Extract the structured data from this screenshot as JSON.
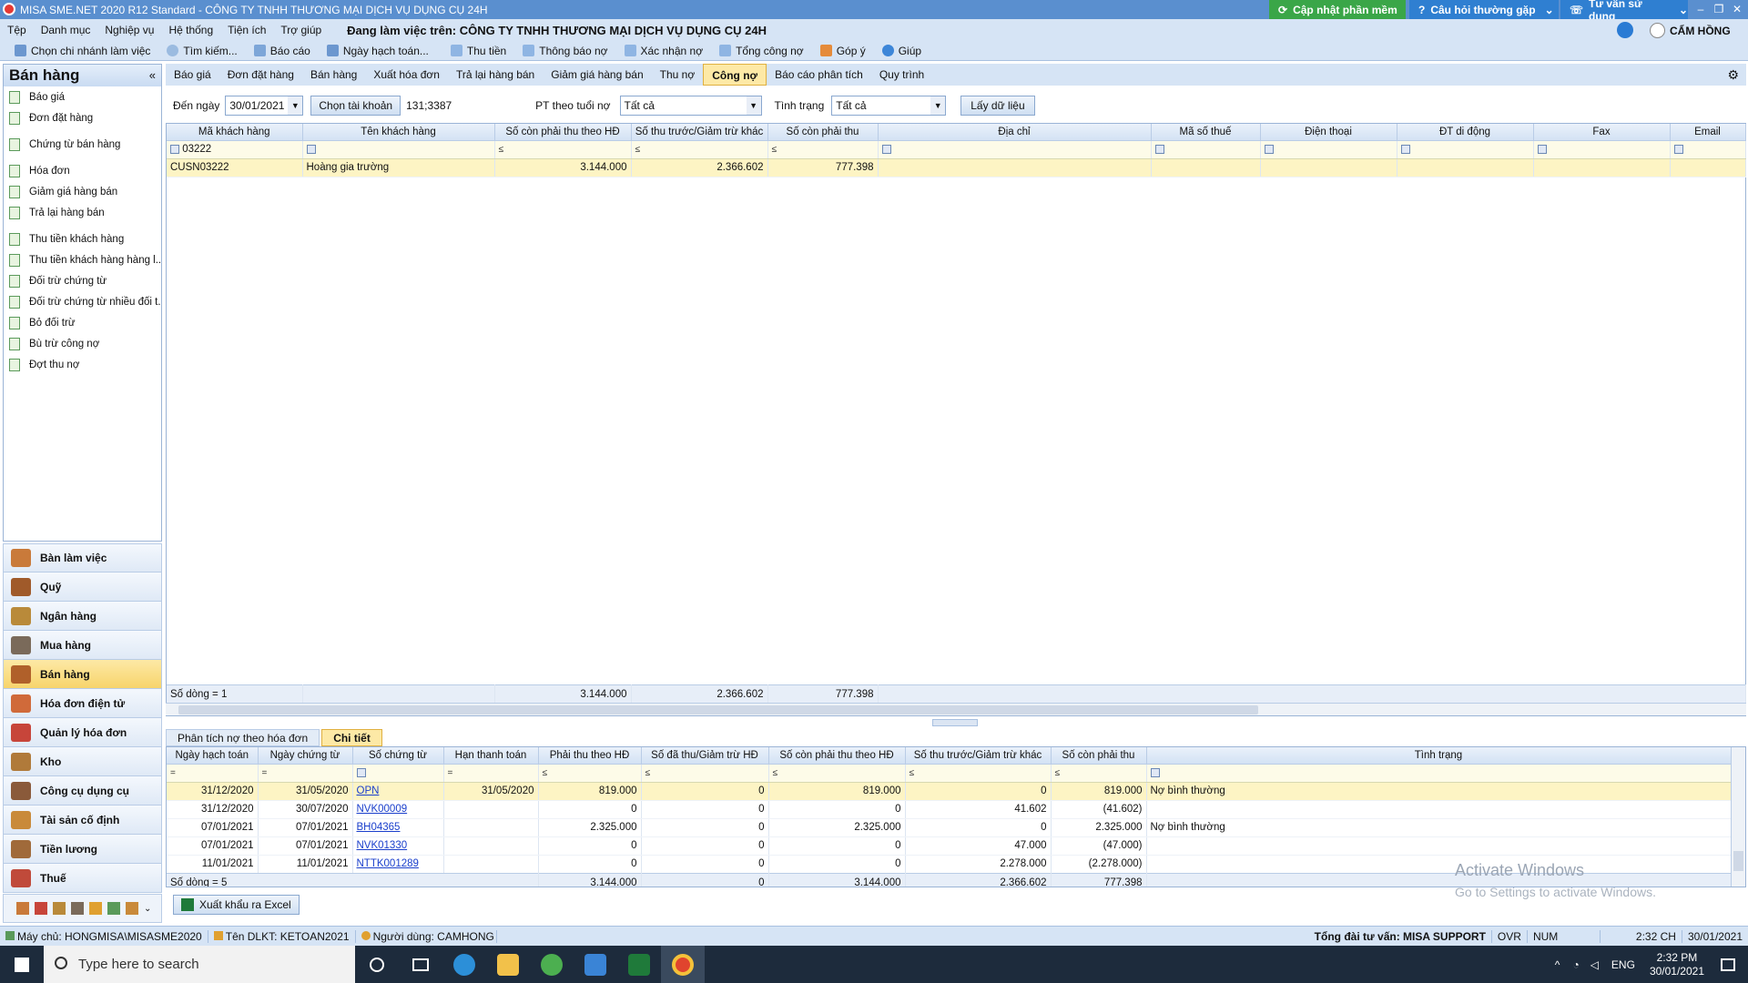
{
  "window": {
    "title": "MISA SME.NET 2020 R12 Standard - CÔNG TY TNHH THƯƠNG MẠI DỊCH VỤ DỤNG CỤ 24H",
    "update_label": "Cập nhật phần mềm",
    "faq_label": "Câu hỏi thường gặp",
    "consult_label": "Tư vấn sử dụng",
    "min": "–",
    "max": "❐",
    "close": "✕"
  },
  "menu": {
    "items": [
      "Tệp",
      "Danh mục",
      "Nghiệp vụ",
      "Hệ thống",
      "Tiện ích",
      "Trợ giúp"
    ],
    "company_label": "Đang làm việc trên: CÔNG TY TNHH THƯƠNG MẠI DỊCH VỤ DỤNG CỤ 24H",
    "user": "CẨM HỒNG"
  },
  "toolbar": {
    "items": [
      "Chọn chi nhánh làm việc",
      "Tìm kiếm...",
      "Báo cáo",
      "Ngày hạch toán...",
      "Thu tiền",
      "Thông báo nợ",
      "Xác nhận nợ",
      "Tổng công nợ",
      "Góp ý",
      "Giúp"
    ]
  },
  "sidebar": {
    "title": "Bán hàng",
    "collapse": "«",
    "items": [
      "Báo giá",
      "Đơn đặt hàng",
      "Chứng từ bán hàng",
      "Hóa đơn",
      "Giảm giá hàng bán",
      "Trả lại hàng bán",
      "Thu tiền khách hàng",
      "Thu tiền khách hàng hàng l...",
      "Đối trừ chứng từ",
      "Đối trừ chứng từ nhiều đối t...",
      "Bỏ đối trừ",
      "Bù trừ công nợ",
      "Đợt thu nợ"
    ],
    "modules": [
      "Bàn làm việc",
      "Quỹ",
      "Ngân hàng",
      "Mua hàng",
      "Bán hàng",
      "Hóa đơn điện tử",
      "Quản lý hóa đơn",
      "Kho",
      "Công cụ dụng cụ",
      "Tài sản cố định",
      "Tiền lương",
      "Thuế"
    ],
    "active_module": "Bán hàng"
  },
  "tabs": {
    "items": [
      "Báo giá",
      "Đơn đặt hàng",
      "Bán hàng",
      "Xuất hóa đơn",
      "Trả lại hàng bán",
      "Giảm giá hàng bán",
      "Thu nợ",
      "Công nợ",
      "Báo cáo phân tích",
      "Quy trình"
    ],
    "active": "Công nợ"
  },
  "filter": {
    "date_label": "Đến ngày",
    "date_value": "30/01/2021",
    "account_btn": "Chọn tài khoản",
    "account_value": "131;3387",
    "aging_label": "PT theo tuổi nợ",
    "aging_value": "Tất cả",
    "status_label": "Tình trạng",
    "status_value": "Tất cả",
    "load_btn": "Lấy dữ liệu"
  },
  "grid1": {
    "headers": [
      "Mã khách hàng",
      "Tên khách hàng",
      "Số còn phải thu theo HĐ",
      "Số thu trước/Giảm trừ khác",
      "Số còn phải thu",
      "Địa chỉ",
      "Mã số thuế",
      "Điện thoại",
      "ĐT di động",
      "Fax",
      "Email"
    ],
    "filter_code": "03222",
    "op": "≤",
    "rows": [
      [
        "CUSN03222",
        "Hoàng gia trường",
        "3.144.000",
        "2.366.602",
        "777.398",
        "",
        "",
        "",
        "",
        "",
        ""
      ]
    ],
    "footer": {
      "count": "Số dòng = 1",
      "sum1": "3.144.000",
      "sum2": "2.366.602",
      "sum3": "777.398"
    }
  },
  "tabs2": {
    "items": [
      "Phân tích nợ theo hóa đơn",
      "Chi tiết"
    ],
    "active": "Chi tiết"
  },
  "grid2": {
    "headers": [
      "Ngày hạch toán",
      "Ngày chứng từ",
      "Số chứng từ",
      "Hạn thanh toán",
      "Phải thu theo HĐ",
      "Số đã thu/Giảm trừ HĐ",
      "Số còn phải thu theo HĐ",
      "Số thu trước/Giảm trừ khác",
      "Số còn phải thu",
      "Tình trạng"
    ],
    "eq": "=",
    "op": "≤",
    "rows": [
      [
        "31/12/2020",
        "31/05/2020",
        "OPN",
        "31/05/2020",
        "819.000",
        "0",
        "819.000",
        "0",
        "819.000",
        "Nợ bình thường"
      ],
      [
        "31/12/2020",
        "30/07/2020",
        "NVK00009",
        "",
        "0",
        "0",
        "0",
        "41.602",
        "(41.602)",
        ""
      ],
      [
        "07/01/2021",
        "07/01/2021",
        "BH04365",
        "",
        "2.325.000",
        "0",
        "2.325.000",
        "0",
        "2.325.000",
        "Nợ bình thường"
      ],
      [
        "07/01/2021",
        "07/01/2021",
        "NVK01330",
        "",
        "0",
        "0",
        "0",
        "47.000",
        "(47.000)",
        ""
      ],
      [
        "11/01/2021",
        "11/01/2021",
        "NTTK001289",
        "",
        "0",
        "0",
        "0",
        "2.278.000",
        "(2.278.000)",
        ""
      ]
    ],
    "footer": {
      "count": "Số dòng = 5",
      "c1": "3.144.000",
      "c2": "0",
      "c3": "3.144.000",
      "c4": "2.366.602",
      "c5": "777.398"
    }
  },
  "export_btn": "Xuất khẩu ra Excel",
  "watermark": {
    "line1": "Activate Windows",
    "line2": "Go to Settings to activate Windows."
  },
  "status": {
    "server": "Máy chủ: HONGMISA\\MISASME2020",
    "db": "Tên DLKT: KETOAN2021",
    "user": "Người dùng: CAMHONG",
    "support": "Tổng đài tư vấn: MISA SUPPORT",
    "ovr": "OVR",
    "num": "NUM",
    "time": "2:32 CH",
    "date": "30/01/2021"
  },
  "taskbar": {
    "search_placeholder": "Type here to search",
    "lang": "ENG",
    "time": "2:32 PM",
    "date": "30/01/2021"
  }
}
